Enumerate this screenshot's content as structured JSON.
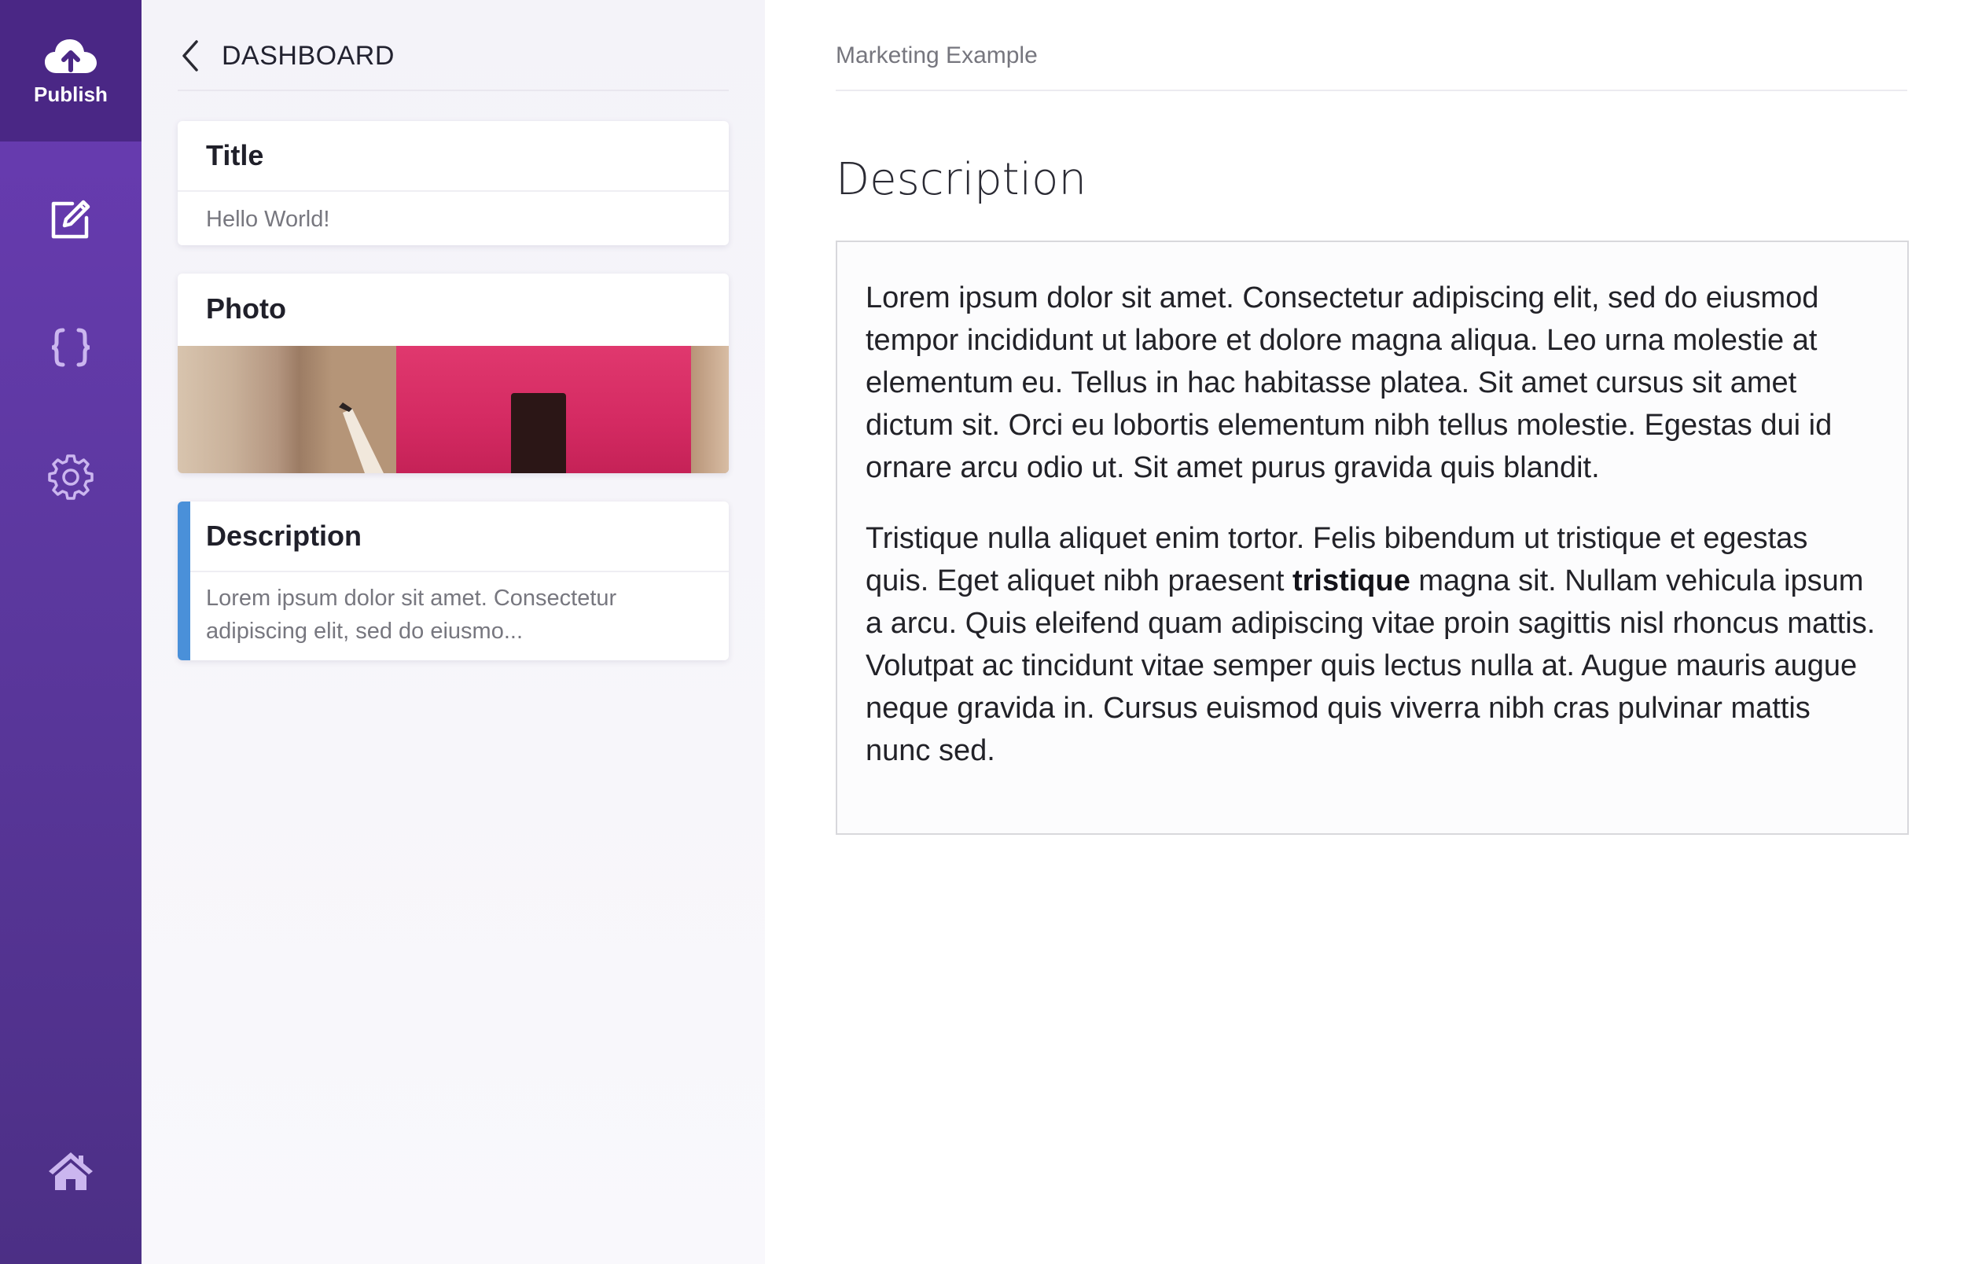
{
  "rail": {
    "publish_label": "Publish",
    "items": [
      {
        "icon": "edit-icon"
      },
      {
        "icon": "code-braces-icon"
      },
      {
        "icon": "gear-icon"
      },
      {
        "icon": "home-icon"
      }
    ],
    "colors": {
      "top": "#6a3cb4",
      "bottom": "#4c2f85",
      "publish_bg": "#4a2785"
    }
  },
  "panel": {
    "back_label": "DASHBOARD",
    "cards": {
      "title": {
        "label": "Title",
        "value": "Hello World!"
      },
      "photo": {
        "label": "Photo"
      },
      "description": {
        "label": "Description",
        "preview_line1": "Lorem ipsum dolor sit amet. Consectetur",
        "preview_line2": "adipiscing elit, sed do eiusmo..."
      }
    },
    "accent_color": "#4a90d9"
  },
  "editor": {
    "breadcrumb": "Marketing Example",
    "field_label": "Description",
    "paragraph1": "Lorem ipsum dolor sit amet. Consectetur adipiscing elit, sed do eiusmod tempor incididunt ut labore et dolore magna aliqua. Leo urna molestie at elementum eu. Tellus in hac habitasse platea. Sit amet cursus sit amet dictum sit. Orci eu lobortis elementum nibh tellus molestie. Egestas dui id ornare arcu odio ut. Sit amet purus gravida quis blandit.",
    "paragraph2_before": "Tristique nulla aliquet enim tortor. Felis bibendum ut tristique et egestas quis. Eget aliquet nibh praesent ",
    "paragraph2_bold": "tristique",
    "paragraph2_after": " magna sit. Nullam vehicula ipsum a arcu. Quis eleifend quam adipiscing vitae proin sagittis nisl rhoncus mattis. Volutpat ac tincidunt vitae semper quis lectus nulla at. Augue mauris augue neque gravida in. Cursus euismod quis viverra nibh cras pulvinar mattis nunc sed."
  }
}
